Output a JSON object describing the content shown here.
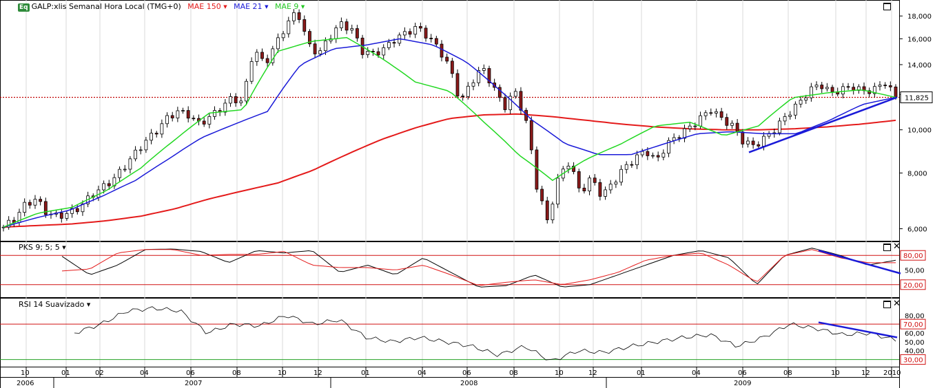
{
  "header": {
    "badge": "Eq",
    "symbol": "GALP:xlis Semanal Hora Local (TMG+0)",
    "ma150": "MAE 150",
    "ma21": "MAE 21",
    "ma9": "MAE 9"
  },
  "panels": {
    "pks_label": "PKS 9; 5; 5",
    "rsi_label": "RSI 14 Suavizado"
  },
  "colors": {
    "ma150": "#e41a1a",
    "ma21": "#1a1ad8",
    "ma9": "#22d822",
    "candle_up": "#ffffff",
    "candle_down": "#8b1a1a",
    "trendline": "#1a1ad8"
  },
  "chart_data": [
    {
      "type": "candlestick",
      "name": "price",
      "scale": "log",
      "ylim": [
        5800,
        19000
      ],
      "y_ticks": [
        "6,000",
        "8,000",
        "10,000",
        "12,000",
        "14,000",
        "16,000",
        "18,000"
      ],
      "last_price": "11,825",
      "last_value": 11825,
      "x_months": [
        "10",
        "01",
        "02",
        "04",
        "06",
        "08",
        "10",
        "12",
        "01",
        "04",
        "06",
        "08",
        "10",
        "12",
        "01",
        "04",
        "06",
        "08",
        "10",
        "12",
        "2010"
      ],
      "x_years": [
        "2006",
        "2007",
        "2008",
        "2009"
      ],
      "close_path": [
        6050,
        6300,
        6800,
        7000,
        6500,
        6400,
        6500,
        6700,
        7100,
        7400,
        7700,
        8200,
        8800,
        9400,
        9900,
        10600,
        11000,
        10800,
        10300,
        10700,
        11200,
        11800,
        11500,
        15200,
        14000,
        15500,
        17200,
        18500,
        15500,
        14800,
        16200,
        17300,
        16800,
        15000,
        14800,
        15200,
        16000,
        16500,
        17000,
        16200,
        15200,
        13800,
        11500,
        12800,
        13800,
        12500,
        11200,
        12200,
        10500,
        7500,
        6200,
        7800,
        8500,
        7200,
        7800,
        7100,
        7600,
        8200,
        8600,
        9000,
        8500,
        9300,
        9700,
        10100,
        10600,
        11100,
        10600,
        10200,
        9400,
        9200,
        9600,
        10100,
        10800,
        11400,
        12200,
        12700,
        12100,
        12300,
        12500,
        12200,
        12300,
        12800,
        11825
      ],
      "ma150_path": [
        6050,
        6100,
        6150,
        6250,
        6400,
        6650,
        7000,
        7300,
        7600,
        8100,
        8800,
        9500,
        10100,
        10600,
        10800,
        10850,
        10700,
        10500,
        10300,
        10150,
        10050,
        10000,
        10000,
        10050,
        10150,
        10300,
        10500
      ],
      "ma21_path": [
        6050,
        6350,
        6600,
        7100,
        7700,
        8600,
        9600,
        10300,
        11000,
        14000,
        15200,
        15500,
        16000,
        15500,
        14200,
        12300,
        10500,
        9300,
        8800,
        8800,
        9300,
        9800,
        9900,
        9800,
        9800,
        10500,
        11400,
        11825
      ],
      "ma9_path": [
        6050,
        6500,
        6700,
        7300,
        8200,
        9500,
        10900,
        11100,
        15000,
        15800,
        16100,
        14500,
        12800,
        12200,
        10400,
        8800,
        7700,
        8600,
        9300,
        10200,
        10400,
        9700,
        10200,
        11800,
        12100,
        12300,
        11825
      ],
      "trendline": {
        "from": [
          8900,
          "2009-06"
        ],
        "to": [
          11825,
          "2010-01"
        ]
      }
    },
    {
      "type": "line",
      "name": "PKS 9; 5; 5",
      "ylim": [
        0,
        100
      ],
      "levels": [
        {
          "value": 80,
          "label": "80,00"
        },
        {
          "value": 20,
          "label": "20,00"
        }
      ],
      "y_ticks": [
        "50,00"
      ],
      "series": [
        {
          "color": "#000000",
          "values": [
            78,
            40,
            60,
            92,
            93,
            88,
            65,
            90,
            85,
            90,
            45,
            60,
            40,
            75,
            45,
            15,
            18,
            40,
            15,
            20,
            40,
            60,
            80,
            90,
            75,
            20,
            80,
            95,
            80,
            60,
            70
          ]
        },
        {
          "color": "#e41a1a",
          "values": [
            48,
            52,
            85,
            92,
            92,
            80,
            82,
            82,
            88,
            60,
            55,
            55,
            50,
            60,
            40,
            18,
            25,
            30,
            20,
            30,
            45,
            70,
            80,
            85,
            60,
            25,
            80,
            92,
            75,
            65,
            65
          ]
        }
      ],
      "trendline": {
        "from": [
          90,
          "2009-10"
        ],
        "to": [
          50,
          "2010-01"
        ]
      }
    },
    {
      "type": "line",
      "name": "RSI 14 Suavizado",
      "ylim": [
        25,
        95
      ],
      "levels": [
        {
          "value": 70,
          "label": "70,00"
        },
        {
          "value": 30,
          "label": "30,00"
        }
      ],
      "y_ticks": [
        "80,00",
        "60,00",
        "50,00",
        "40,00"
      ],
      "series": [
        {
          "color": "#000000",
          "values": [
            60,
            70,
            85,
            88,
            85,
            60,
            70,
            68,
            80,
            70,
            75,
            55,
            50,
            55,
            50,
            45,
            35,
            45,
            28,
            40,
            38,
            45,
            50,
            55,
            58,
            45,
            55,
            70,
            65,
            58,
            60,
            52
          ]
        }
      ],
      "trendline": {
        "from": [
          72,
          "2009-10"
        ],
        "to": [
          55,
          "2010-01"
        ]
      }
    }
  ]
}
